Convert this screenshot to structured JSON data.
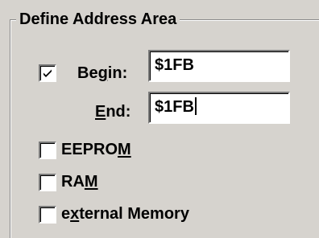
{
  "group": {
    "title": "Define Address Area"
  },
  "begin": {
    "checked": true,
    "label_pre": "Be",
    "label_accel": "g",
    "label_post": "in:",
    "value": "$1FB"
  },
  "end": {
    "label_accel": "E",
    "label_post": "nd:",
    "value": "$1FB"
  },
  "options": [
    {
      "label_pre": "EEPRO",
      "label_accel": "M",
      "label_post": "",
      "checked": false
    },
    {
      "label_pre": "RA",
      "label_accel": "M",
      "label_post": "",
      "checked": false
    },
    {
      "label_pre": "e",
      "label_accel": "x",
      "label_post": "ternal Memory",
      "checked": false
    }
  ],
  "colors": {
    "face": "#d6d3ce",
    "field": "#ffffff",
    "shadow": "#7a7a7a"
  }
}
